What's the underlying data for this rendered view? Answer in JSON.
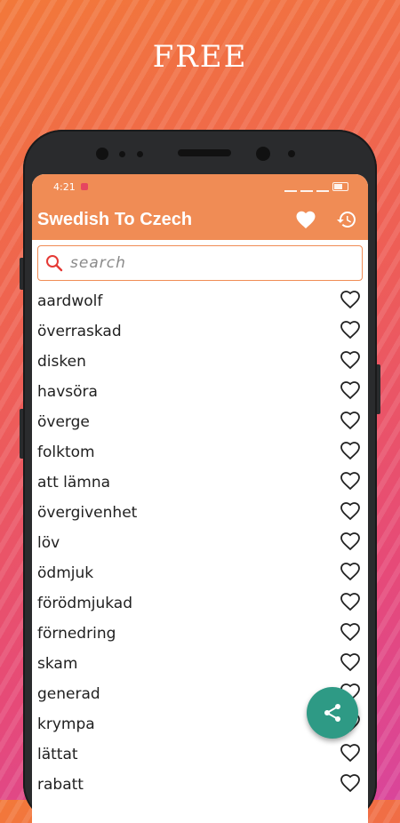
{
  "promo": {
    "title": "FREE"
  },
  "status_bar": {
    "time": "4:21"
  },
  "app_bar": {
    "title": "Swedish To Czech"
  },
  "search": {
    "placeholder": "search"
  },
  "words": [
    "aardwolf",
    "överraskad",
    "disken",
    "havsöra",
    "överge",
    "folktom",
    "att lämna",
    "övergivenhet",
    "löv",
    "ödmjuk",
    "förödmjukad",
    "förnedring",
    "skam",
    "generad",
    "krympa",
    "lättat",
    "rabatt"
  ],
  "colors": {
    "primary": "#f08c55",
    "fab": "#2e9a85"
  },
  "icons": {
    "app_bar": [
      "heart-icon",
      "history-icon"
    ],
    "row": "heart-outline-icon",
    "fab": "share-icon",
    "search": "search-icon"
  }
}
